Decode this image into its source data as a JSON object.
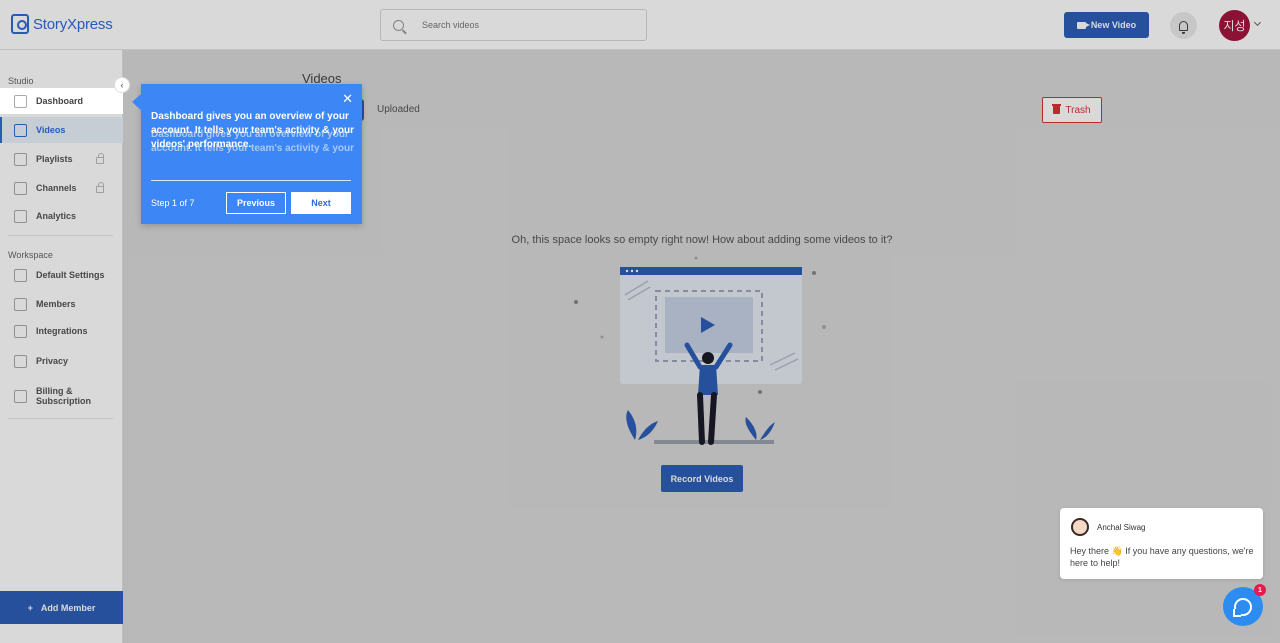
{
  "header": {
    "logo_text": "StoryXpress",
    "search_placeholder": "Search videos",
    "new_video_label": "New Video",
    "avatar_text": "지성"
  },
  "sidebar": {
    "studio_label": "Studio",
    "studio_items": [
      {
        "label": "Dashboard",
        "icon": "dashboard-icon"
      },
      {
        "label": "Videos",
        "icon": "video-icon"
      },
      {
        "label": "Playlists",
        "icon": "playlist-icon",
        "locked": true
      },
      {
        "label": "Channels",
        "icon": "channels-icon",
        "locked": true
      },
      {
        "label": "Analytics",
        "icon": "analytics-icon"
      }
    ],
    "workspace_label": "Workspace",
    "workspace_items": [
      {
        "label": "Default Settings",
        "icon": "settings-icon"
      },
      {
        "label": "Members",
        "icon": "members-icon"
      },
      {
        "label": "Integrations",
        "icon": "integrations-icon"
      },
      {
        "label": "Privacy",
        "icon": "privacy-icon"
      },
      {
        "label": "Billing & Subscription",
        "line1": "Billing &",
        "line2": "Subscription",
        "icon": "billing-icon"
      }
    ],
    "add_member_label": "Add Member",
    "collapse_glyph": "‹"
  },
  "main": {
    "title": "Videos",
    "tabs": [
      {
        "label": "Uploaded"
      }
    ],
    "trash_label": "Trash",
    "empty_message": "Oh, this space looks so empty right now! How about adding some videos to it?",
    "record_label": "Record Videos"
  },
  "tour": {
    "text": "Dashboard gives you an overview of your account. It tells your team's activity & your videos' performance.",
    "ghost_text": "Dashboard gives you an overview of your account. It tells your team's activity & your",
    "step": "Step 1 of 7",
    "previous_label": "Previous",
    "next_label": "Next",
    "close_glyph": "✕"
  },
  "chat": {
    "agent_name": "Anchal Siwag",
    "message": "Hey there 👋 If you have any questions, we're here to help!",
    "badge_count": "1"
  },
  "colors": {
    "primary": "#2d5fb8",
    "tour_bg": "#3d86f6",
    "danger": "#dd3333",
    "avatar_bg": "#a5163f",
    "badge": "#e81a4b"
  }
}
